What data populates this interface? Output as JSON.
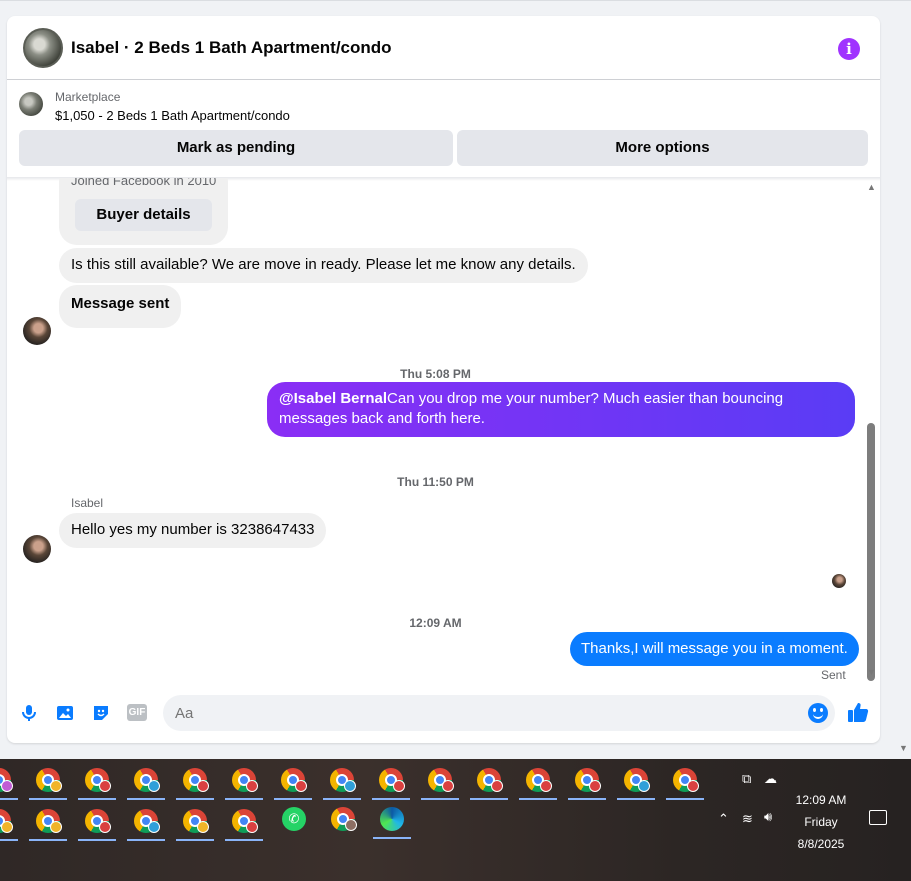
{
  "header": {
    "title": "Isabel · 2 Beds 1 Bath Apartment/condo"
  },
  "marketplace": {
    "label": "Marketplace",
    "listing": "$1,050 - 2 Beds 1 Bath Apartment/condo",
    "mark_pending": "Mark as pending",
    "more_options": "More options"
  },
  "chat": {
    "joined": "Joined Facebook in 2010",
    "buyer_details": "Buyer details",
    "msg_available": "Is this still available? We are move in ready. Please let me know any details.",
    "msg_sent": "Message sent",
    "stamp_thu_508": "Thu 5:08 PM",
    "msg_drop_mention": "@Isabel Bernal",
    "msg_drop_text": "Can you drop me your number? Much easier than bouncing messages back and forth here.",
    "stamp_thu_1150": "Thu 11:50 PM",
    "sender_name": "Isabel",
    "msg_hello": "Hello yes my number is 3238647433",
    "stamp_1209": "12:09 AM",
    "msg_thanks": "Thanks,I will message you in a moment.",
    "sent_status": "Sent"
  },
  "composer": {
    "placeholder": "Aa",
    "gif": "GIF"
  },
  "taskbar": {
    "time": "12:09 AM",
    "day": "Friday",
    "date": "8/8/2025",
    "row1_badge_colors": [
      "#c05bd5",
      "#f0b429",
      "#d94040",
      "#2f9fd9",
      "#d94040",
      "#d94040",
      "#d94040",
      "#2f9fd9",
      "#d94040",
      "#d94040",
      "#d94040",
      "#d94040",
      "#d94040",
      "#2f9fd9",
      "#d94040"
    ],
    "row2_badge_colors": [
      "#f0b429",
      "#f0b429",
      "#d94040",
      "#2f9fd9",
      "#f0b429",
      "#d94040"
    ]
  },
  "colors": {
    "accent": "#0a7cff",
    "info": "#a033ff",
    "purple_bubble": "#7b30f5"
  }
}
